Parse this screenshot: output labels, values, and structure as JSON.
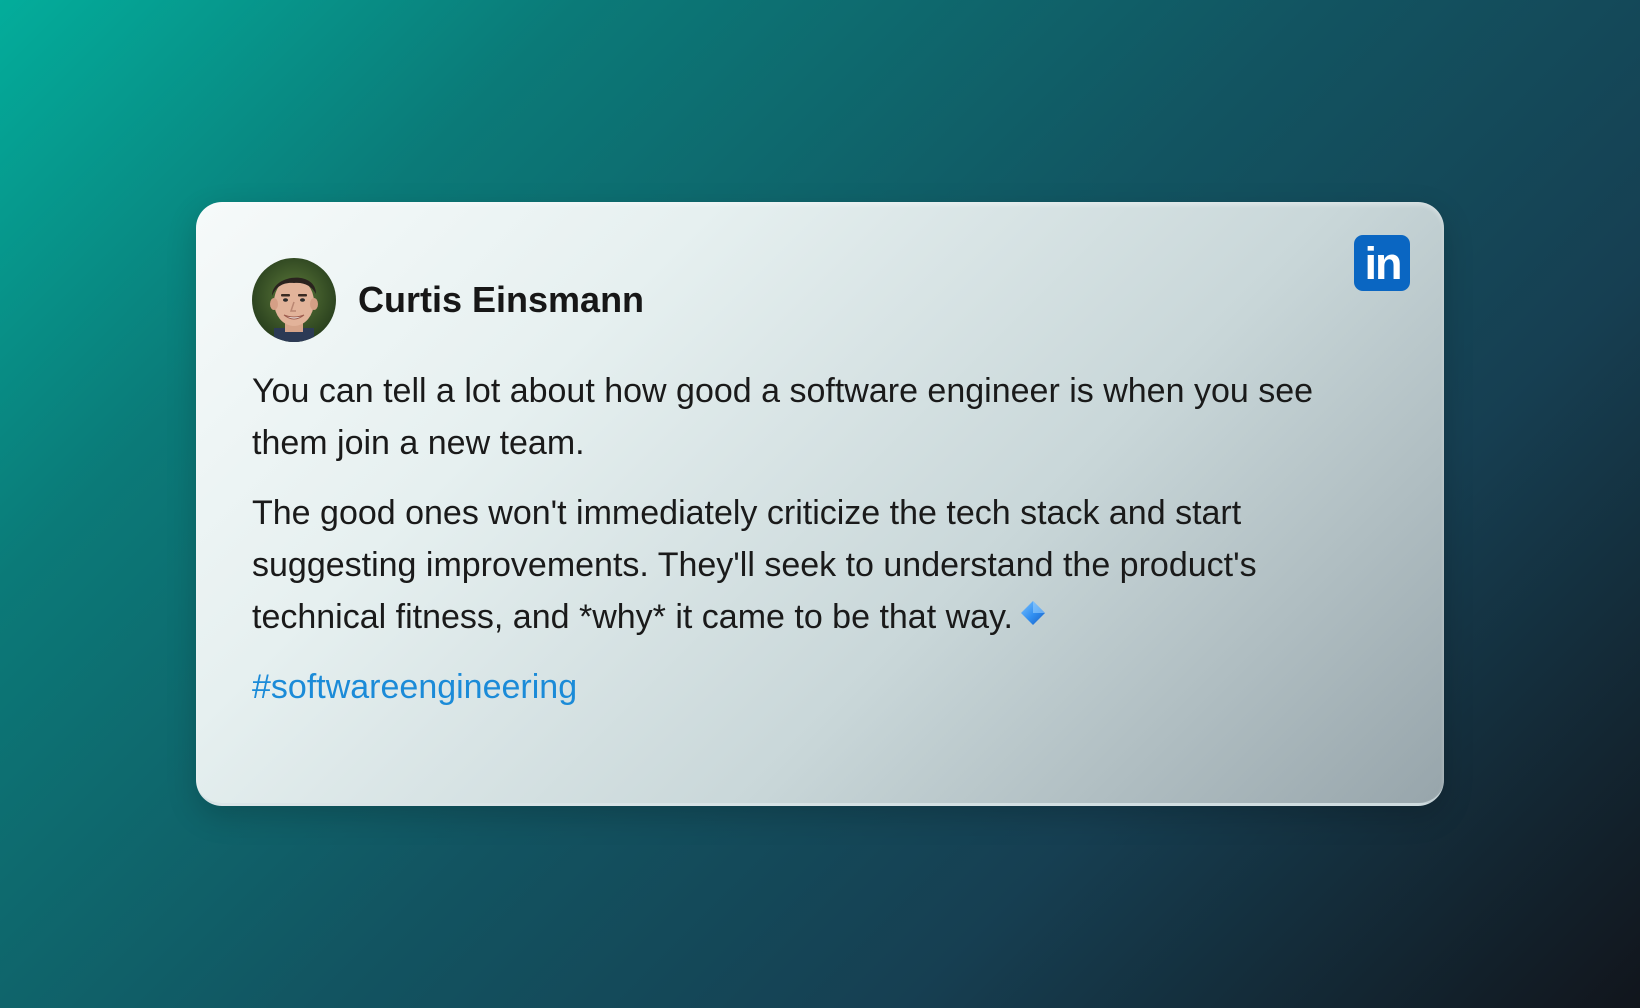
{
  "author": {
    "name": "Curtis Einsmann",
    "avatar_icon": "profile-photo"
  },
  "platform": {
    "name": "LinkedIn",
    "logo_text": "in",
    "brand_color": "#0a66c2"
  },
  "post": {
    "paragraphs": [
      "You can tell a lot about how good a software engineer is when you see them join a new team.",
      "The good ones won't immediately criticize the tech stack and start suggesting improvements. They'll seek to understand the product's technical fitness, and *why* it came to be that way."
    ],
    "trailing_icon": "small-blue-diamond",
    "hashtag": "#softwareengineering",
    "hashtag_color": "#1b8bd8"
  }
}
